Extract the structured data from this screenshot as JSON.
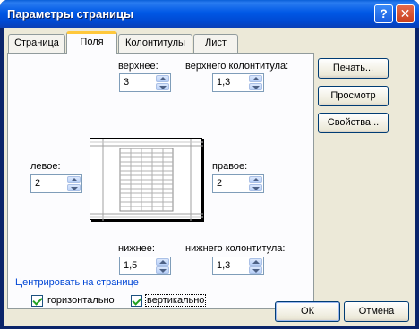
{
  "window": {
    "title": "Параметры страницы",
    "help_glyph": "?",
    "close_glyph": "✕"
  },
  "tabs": [
    {
      "label": "Страница",
      "active": false
    },
    {
      "label": "Поля",
      "active": true
    },
    {
      "label": "Колонтитулы",
      "active": false
    },
    {
      "label": "Лист",
      "active": false
    }
  ],
  "margins": {
    "top": {
      "label": "верхнее:",
      "value": "3"
    },
    "header": {
      "label": "верхнего колонтитула:",
      "value": "1,3"
    },
    "left": {
      "label": "левое:",
      "value": "2"
    },
    "right": {
      "label": "правое:",
      "value": "2"
    },
    "bottom": {
      "label": "нижнее:",
      "value": "1,5"
    },
    "footer": {
      "label": "нижнего колонтитула:",
      "value": "1,3"
    }
  },
  "center": {
    "group_label": "Центрировать на странице",
    "horizontal": {
      "label": "горизонтально",
      "checked": true
    },
    "vertical": {
      "label": "вертикально",
      "checked": true
    }
  },
  "side_buttons": {
    "print": "Печать...",
    "preview": "Просмотр",
    "properties": "Свойства..."
  },
  "footer_buttons": {
    "ok": "ОК",
    "cancel": "Отмена"
  },
  "colors": {
    "title_bar": "#0058e6",
    "dialog_bg": "#ece9d8",
    "panel_bg": "#fcfcfe",
    "tab_highlight": "#ffc83c",
    "check_mark": "#21a121"
  }
}
